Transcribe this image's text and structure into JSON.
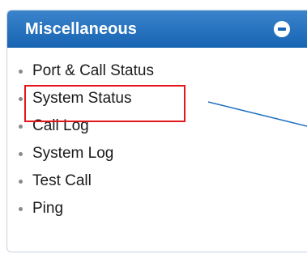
{
  "panel": {
    "title": "Miscellaneous",
    "collapse_icon": "minus-circle-icon",
    "header_color": "#1e6fbf"
  },
  "menu": {
    "items": [
      {
        "label": "Port & Call Status"
      },
      {
        "label": "System Status"
      },
      {
        "label": "Call Log"
      },
      {
        "label": "System Log"
      },
      {
        "label": "Test Call"
      },
      {
        "label": "Ping"
      }
    ]
  },
  "annotation": {
    "highlighted_item": "System Status",
    "highlight_color": "#e3161c",
    "pointer_line_color": "#1e6fbf"
  }
}
